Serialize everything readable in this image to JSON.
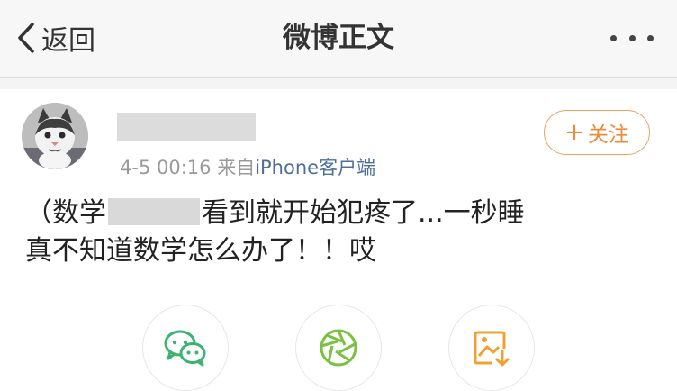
{
  "navbar": {
    "back_label": "返回",
    "title": "微博正文",
    "more_icon": "more-dots-icon"
  },
  "post": {
    "time": "4-5 00:16",
    "source_prefix": "来自",
    "source": "iPhone客户端",
    "follow_label": "关注",
    "line1_a": "（数学",
    "line1_b": "看到就开始犯疼了...一秒睡",
    "line2": "真不知道数学怎么办了！！哎"
  },
  "share": {
    "items": [
      {
        "icon": "wechat-icon",
        "color": "#3cb371"
      },
      {
        "icon": "moments-aperture-icon",
        "color": "#7ac143"
      },
      {
        "icon": "save-image-icon",
        "color": "#f0a030"
      }
    ]
  },
  "colors": {
    "accent": "#ee8a3a",
    "link": "#4e6f9a",
    "navbar_bg": "#f7f7f7"
  }
}
